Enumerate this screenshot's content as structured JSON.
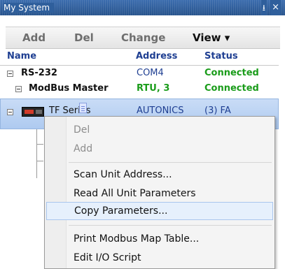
{
  "window": {
    "title": "My System",
    "pin_glyph": "⭳",
    "close_glyph": "×"
  },
  "toolbar": {
    "add": "Add",
    "del": "Del",
    "change": "Change",
    "view": "View ▾"
  },
  "columns": {
    "name": "Name",
    "address": "Address",
    "status": "Status"
  },
  "tree": {
    "rs232": {
      "name": "RS-232",
      "address": "COM4",
      "status": "Connected"
    },
    "modbus": {
      "name": "ModBus Master",
      "address": "RTU, 3",
      "status": "Connected"
    },
    "device": {
      "name": "TF Series",
      "address": "AUTONICS",
      "status": "(3) FA"
    }
  },
  "colors": {
    "connected": "#1a9c1a",
    "address_blue": "#1f3f92",
    "selection": "#b9d2f3"
  },
  "context_menu": {
    "del": "Del",
    "add": "Add",
    "scan": "Scan Unit Address...",
    "read_all": "Read All Unit Parameters",
    "copy": "Copy Parameters...",
    "print": "Print Modbus Map Table...",
    "edit_io": "Edit I/O Script"
  }
}
